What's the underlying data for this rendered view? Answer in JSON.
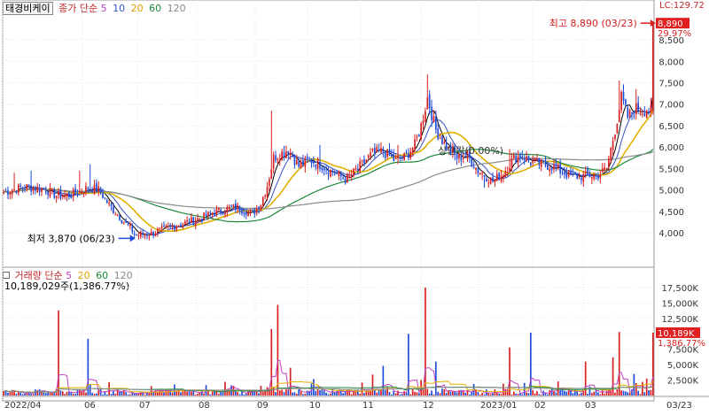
{
  "header": {
    "stock_name": "태경비케이",
    "price_indicator": "종가 단순",
    "ma_periods": [
      "5",
      "10",
      "20",
      "60",
      "120"
    ],
    "corner_tag": "LC:129.72"
  },
  "volume_header": {
    "title": "거래량 단순",
    "ma_periods": [
      "5",
      "20",
      "60",
      "120"
    ],
    "current_volume": "10,189,029주(1,386.77%)"
  },
  "colors": {
    "up": "#d81e1e",
    "down": "#1e4bd8",
    "ma5": "#000000",
    "ma10": "#3050c8",
    "ma20": "#e0b000",
    "ma60": "#1a8a3a",
    "ma120": "#8a8a8a",
    "vol_ma5": "#c040c0",
    "vol_ma20": "#e0b000",
    "vol_ma60": "#1a8a3a",
    "vol_ma120": "#8a8a8a",
    "tag_bg": "#e02020"
  },
  "chart_data": [
    {
      "type": "candlestick",
      "ylim": [
        3300,
        9100
      ],
      "yticks": [
        "4,000",
        "4,500",
        "5,000",
        "5,500",
        "6,000",
        "6,500",
        "7,000",
        "7,500",
        "8,000",
        "8,500"
      ],
      "xticks": [
        "2022/04",
        "06",
        "07",
        "08",
        "09",
        "10",
        "11",
        "12",
        "2023/01",
        "02",
        "03",
        "03/23"
      ],
      "current": {
        "label": "8,890",
        "change": "29.97%"
      },
      "annotations": [
        {
          "text": "최고 8,890 (03/23)",
          "value": 8890
        },
        {
          "text": "최저 3,870 (06/23)",
          "value": 3870
        },
        {
          "text": "상단락(0.00%)",
          "value": 5900
        }
      ],
      "close_anchors": [
        [
          0,
          4950
        ],
        [
          10,
          5080
        ],
        [
          20,
          5010
        ],
        [
          25,
          4870
        ],
        [
          32,
          4880
        ],
        [
          40,
          5050
        ],
        [
          45,
          5000
        ],
        [
          50,
          4650
        ],
        [
          58,
          4200
        ],
        [
          63,
          3950
        ],
        [
          70,
          3980
        ],
        [
          80,
          4150
        ],
        [
          90,
          4280
        ],
        [
          100,
          4480
        ],
        [
          110,
          4600
        ],
        [
          118,
          4450
        ],
        [
          122,
          4700
        ],
        [
          125,
          5100
        ],
        [
          128,
          5750
        ],
        [
          135,
          5950
        ],
        [
          140,
          5550
        ],
        [
          145,
          5700
        ],
        [
          150,
          5600
        ],
        [
          155,
          5450
        ],
        [
          162,
          5250
        ],
        [
          165,
          5350
        ],
        [
          175,
          5850
        ],
        [
          180,
          5900
        ],
        [
          185,
          5700
        ],
        [
          190,
          5750
        ],
        [
          195,
          6050
        ],
        [
          198,
          6500
        ],
        [
          201,
          7150
        ],
        [
          205,
          6400
        ],
        [
          210,
          6000
        ],
        [
          215,
          5750
        ],
        [
          220,
          5800
        ],
        [
          225,
          5450
        ],
        [
          232,
          5200
        ],
        [
          237,
          5400
        ],
        [
          242,
          5750
        ],
        [
          246,
          5800
        ],
        [
          250,
          5650
        ],
        [
          260,
          5550
        ],
        [
          270,
          5300
        ],
        [
          282,
          5350
        ],
        [
          286,
          5500
        ],
        [
          290,
          6400
        ],
        [
          293,
          7150
        ],
        [
          296,
          6700
        ],
        [
          300,
          6900
        ],
        [
          303,
          6850
        ],
        [
          305,
          6900
        ],
        [
          307,
          6840
        ],
        [
          308,
          8890
        ]
      ],
      "spikes": [
        [
          5,
          5400
        ],
        [
          13,
          5450
        ],
        [
          22,
          4600
        ],
        [
          36,
          5450
        ],
        [
          41,
          5600
        ],
        [
          127,
          6850
        ],
        [
          150,
          6050
        ],
        [
          187,
          6050
        ],
        [
          201,
          7700
        ],
        [
          240,
          5950
        ],
        [
          292,
          7550
        ],
        [
          300,
          7350
        ]
      ],
      "lows": [
        [
          62,
          3870
        ],
        [
          228,
          5050
        ]
      ]
    },
    {
      "type": "bar",
      "series": "volume",
      "ylim": [
        0,
        18500
      ],
      "yticks": [
        "2,500K",
        "5,000K",
        "7,500K",
        "10,000K",
        "12,500K",
        "15,000K",
        "17,500K"
      ],
      "current": {
        "label": "10,189K",
        "change": "1,386.77%"
      },
      "spikes": [
        [
          26,
          13800
        ],
        [
          40,
          9200
        ],
        [
          127,
          10800
        ],
        [
          130,
          14700
        ],
        [
          136,
          4500
        ],
        [
          175,
          3400
        ],
        [
          180,
          4800
        ],
        [
          192,
          10000
        ],
        [
          200,
          17500
        ],
        [
          205,
          5500
        ],
        [
          240,
          7800
        ],
        [
          250,
          10200
        ],
        [
          276,
          5500
        ],
        [
          289,
          6200
        ],
        [
          292,
          10300
        ],
        [
          299,
          3500
        ],
        [
          308,
          10189
        ]
      ]
    }
  ]
}
